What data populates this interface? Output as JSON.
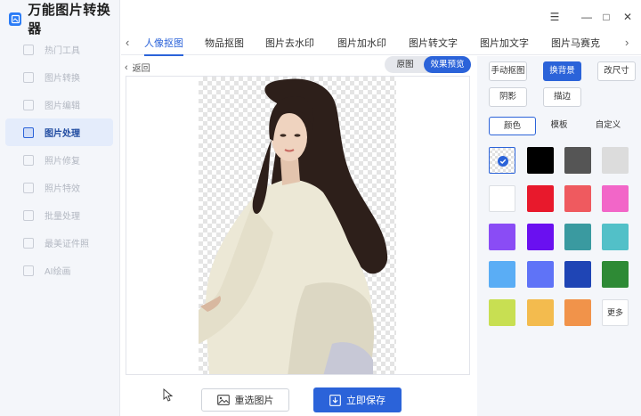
{
  "app": {
    "title": "万能图片转换器"
  },
  "sidebar": {
    "items": [
      {
        "label": "热门工具"
      },
      {
        "label": "图片转换"
      },
      {
        "label": "图片编辑"
      },
      {
        "label": "图片处理",
        "active": true
      },
      {
        "label": "照片修复"
      },
      {
        "label": "照片特效"
      },
      {
        "label": "批量处理"
      },
      {
        "label": "最美证件照"
      },
      {
        "label": "AI绘画"
      }
    ]
  },
  "window": {
    "menu": "☰",
    "minimize": "—",
    "maximize": "□",
    "close": "✕"
  },
  "tabs": {
    "prev": "‹",
    "next": "›",
    "items": [
      {
        "label": "人像抠图",
        "active": true
      },
      {
        "label": "物品抠图"
      },
      {
        "label": "图片去水印"
      },
      {
        "label": "图片加水印"
      },
      {
        "label": "图片转文字"
      },
      {
        "label": "图片加文字"
      },
      {
        "label": "图片马赛克"
      }
    ]
  },
  "canvas": {
    "back": "返回",
    "back_icon": "‹",
    "toggle": {
      "original": "原图",
      "preview": "效果预览"
    }
  },
  "actions": {
    "reselect": "重选图片",
    "save": "立即保存"
  },
  "panel": {
    "tools": {
      "manual_cutout": "手动抠图",
      "change_bg": "换背景",
      "resize": "改尺寸",
      "shadow": "阴影",
      "stroke": "描边"
    },
    "sub_tabs": {
      "color": "颜色",
      "template": "模板",
      "custom": "自定义"
    },
    "more": "更多",
    "swatches": [
      "transparent",
      "#000000",
      "#555555",
      "#dcdcdc",
      "#ffffff",
      "#e8192c",
      "#ef5a5f",
      "#f266c8",
      "#8a4cf5",
      "#6a10f0",
      "#3a9aa0",
      "#52c0c8",
      "#5aadf5",
      "#5f73f7",
      "#1f45b5",
      "#2e8a35",
      "#c8df52",
      "#f3bb4e",
      "#f1934a"
    ]
  },
  "colors": {
    "accent": "#2b63d9",
    "sidebar_bg": "#f4f6fa"
  }
}
